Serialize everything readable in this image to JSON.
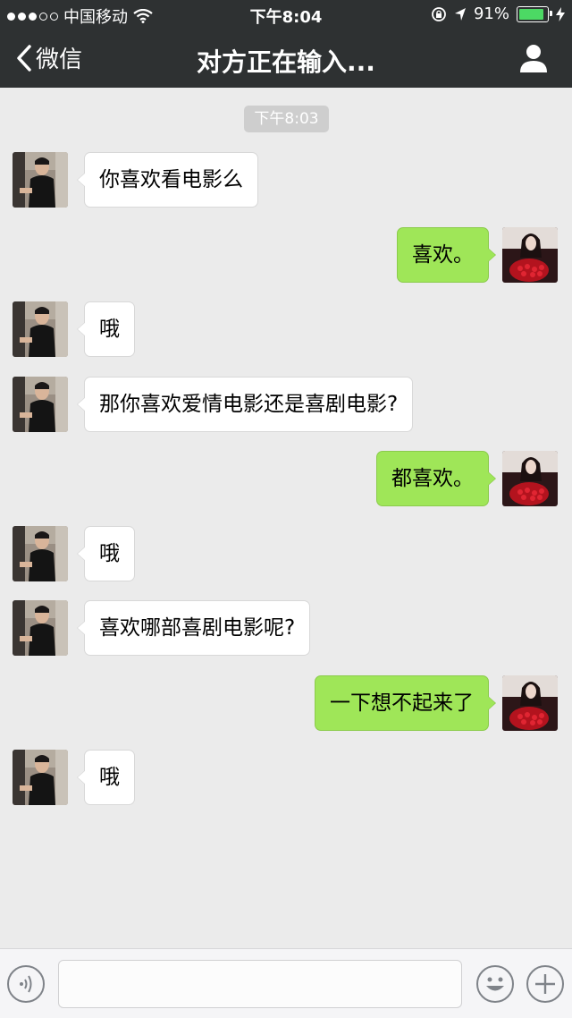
{
  "status_bar": {
    "carrier": "中国移动",
    "time": "下午8:04",
    "battery": "91%"
  },
  "nav": {
    "back_label": "微信",
    "title": "对方正在输入..."
  },
  "chat": {
    "timestamp": "下午8:03",
    "messages": [
      {
        "from": "other",
        "text": "你喜欢看电影么"
      },
      {
        "from": "me",
        "text": "喜欢。"
      },
      {
        "from": "other",
        "text": "哦"
      },
      {
        "from": "other",
        "text": "那你喜欢爱情电影还是喜剧电影?"
      },
      {
        "from": "me",
        "text": "都喜欢。"
      },
      {
        "from": "other",
        "text": "哦"
      },
      {
        "from": "other",
        "text": "喜欢哪部喜剧电影呢?"
      },
      {
        "from": "me",
        "text": "一下想不起来了"
      },
      {
        "from": "other",
        "text": "哦"
      }
    ]
  },
  "input": {
    "value": "",
    "placeholder": ""
  },
  "icons": {
    "back": "chevron-left-icon",
    "profile": "person-icon",
    "voice": "voice-icon",
    "emoji": "emoji-icon",
    "plus": "plus-icon",
    "wifi": "wifi-icon",
    "location": "location-arrow-icon",
    "lock": "rotation-lock-icon",
    "charging": "bolt-icon"
  },
  "colors": {
    "nav_bg": "#2e3132",
    "chat_bg": "#ebebeb",
    "sent_bubble": "#9fe658",
    "recv_bubble": "#ffffff",
    "battery_fill": "#4cd964"
  }
}
